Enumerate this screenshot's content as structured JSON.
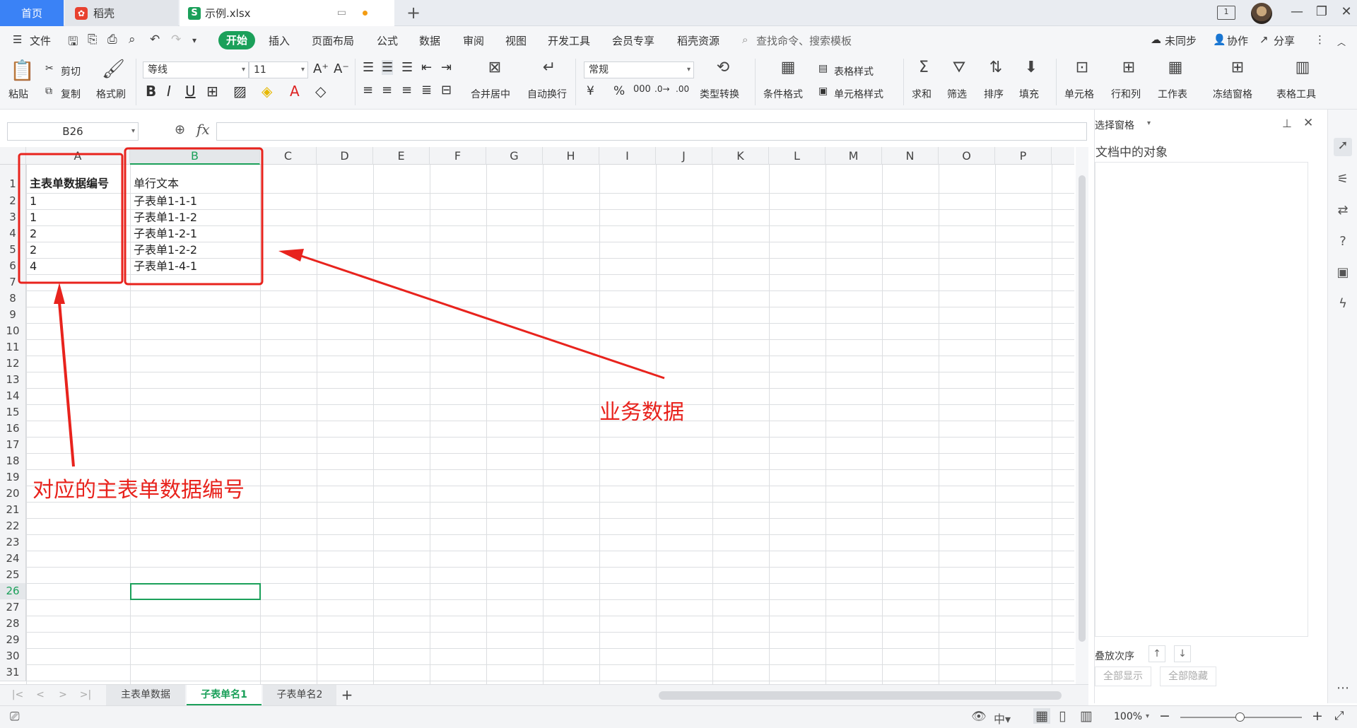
{
  "tabs": {
    "home": "首页",
    "daoke": "稻壳",
    "file": "示例.xlsx",
    "add": "+"
  },
  "menu": {
    "file": "文件",
    "items": [
      "开始",
      "插入",
      "页面布局",
      "公式",
      "数据",
      "审阅",
      "视图",
      "开发工具",
      "会员专享",
      "稻壳资源"
    ],
    "search_placeholder": "查找命令、搜索模板",
    "sync": "未同步",
    "collab": "协作",
    "share": "分享"
  },
  "ribbon": {
    "paste": "粘贴",
    "cut": "剪切",
    "copy": "复制",
    "format_painter": "格式刷",
    "font_name": "等线",
    "font_size": "11",
    "merge_center": "合并居中",
    "wrap_text": "自动换行",
    "number_format": "常规",
    "type_convert": "类型转换",
    "cond_format": "条件格式",
    "table_style": "表格样式",
    "cell_style": "单元格样式",
    "sum": "求和",
    "filter": "筛选",
    "sort": "排序",
    "fill": "填充",
    "cell": "单元格",
    "rows_cols": "行和列",
    "worksheet": "工作表",
    "freeze": "冻结窗格",
    "table_tools": "表格工具"
  },
  "formula_bar": {
    "name_box": "B26",
    "fx": "fx",
    "value": ""
  },
  "grid": {
    "columns": [
      "A",
      "B",
      "C",
      "D",
      "E",
      "F",
      "G",
      "H",
      "I",
      "J",
      "K",
      "L",
      "M",
      "N",
      "O",
      "P"
    ],
    "rows": [
      "1",
      "2",
      "3",
      "4",
      "5",
      "6",
      "7",
      "8",
      "9",
      "10",
      "11",
      "12",
      "13",
      "14",
      "15",
      "16",
      "17",
      "18",
      "19",
      "20",
      "21",
      "22",
      "23",
      "24",
      "25",
      "26",
      "27",
      "28",
      "29",
      "30",
      "31"
    ],
    "cells": {
      "A1": "主表单数据编号",
      "B1": "单行文本",
      "A2": "1",
      "B2": "子表单1-1-1",
      "A3": "1",
      "B3": "子表单1-1-2",
      "A4": "2",
      "B4": "子表单1-2-1",
      "A5": "2",
      "B5": "子表单1-2-2",
      "A6": "4",
      "B6": "子表单1-4-1"
    },
    "selected_cell": "B26"
  },
  "sheet_tabs": [
    "主表单数据",
    "子表单名1",
    "子表单名2"
  ],
  "active_sheet": "子表单名1",
  "selection_pane": {
    "title": "选择窗格",
    "objects_label": "文档中的对象",
    "order_label": "叠放次序",
    "show_all": "全部显示",
    "hide_all": "全部隐藏"
  },
  "status": {
    "zoom": "100%"
  },
  "annotations": {
    "left": "对应的主表单数据编号",
    "right": "业务数据"
  },
  "colors": {
    "accent_green": "#1ba05a",
    "annotation_red": "#e8231d",
    "home_tab_blue": "#3a82f6"
  }
}
